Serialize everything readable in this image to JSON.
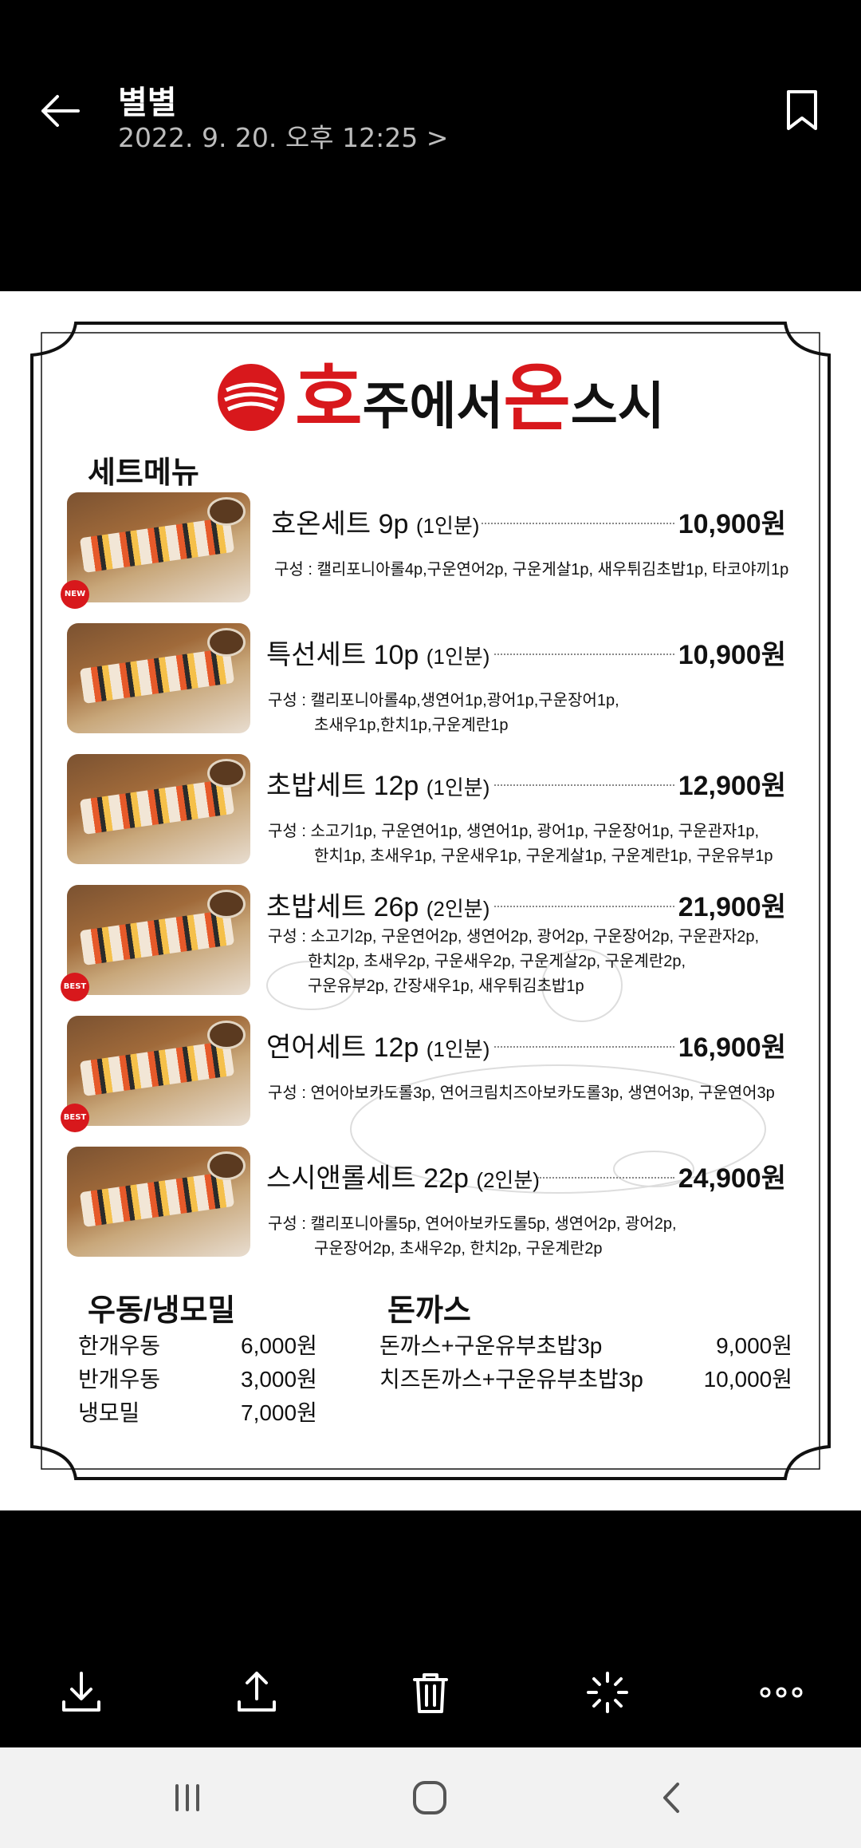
{
  "header": {
    "title": "별별",
    "subtitle": "2022. 9. 20. 오후 12:25 >"
  },
  "menu": {
    "logo": {
      "part1": "호",
      "part2": "주에서",
      "part3": "온",
      "part4": "스시"
    },
    "section_set": "세트메뉴",
    "items": [
      {
        "name": "호온세트 9p",
        "serving": "(1인분)",
        "price": "10,900원",
        "desc1": "구성 : 캘리포니아롤4p,구운연어2p, 구운게살1p, 새우튀김초밥1p, 타코야끼1p",
        "desc2": "",
        "badge": "NEW"
      },
      {
        "name": "특선세트 10p",
        "serving": "(1인분)",
        "price": "10,900원",
        "desc1": "구성 : 캘리포니아롤4p,생연어1p,광어1p,구운장어1p,",
        "desc2": "초새우1p,한치1p,구운계란1p",
        "badge": ""
      },
      {
        "name": "초밥세트 12p",
        "serving": "(1인분)",
        "price": "12,900원",
        "desc1": "구성 : 소고기1p, 구운연어1p, 생연어1p, 광어1p, 구운장어1p, 구운관자1p,",
        "desc2": "한치1p, 초새우1p, 구운새우1p, 구운게살1p, 구운계란1p, 구운유부1p",
        "badge": ""
      },
      {
        "name": "초밥세트 26p",
        "serving": "(2인분)",
        "price": "21,900원",
        "desc1": "구성 : 소고기2p, 구운연어2p, 생연어2p, 광어2p, 구운장어2p, 구운관자2p,",
        "desc2": "한치2p, 초새우2p, 구운새우2p, 구운게살2p, 구운계란2p,",
        "desc3": "구운유부2p, 간장새우1p, 새우튀김초밥1p",
        "badge": "BEST"
      },
      {
        "name": "연어세트 12p",
        "serving": "(1인분)",
        "price": "16,900원",
        "desc1": "구성 : 연어아보카도롤3p, 연어크림치즈아보카도롤3p, 생연어3p, 구운연어3p",
        "desc2": "",
        "badge": "BEST"
      },
      {
        "name": "스시앤롤세트 22p",
        "serving": "(2인분)",
        "price": "24,900원",
        "desc1": "구성 : 캘리포니아롤5p, 연어아보카도롤5p, 생연어2p, 광어2p,",
        "desc2": "구운장어2p, 초새우2p, 한치2p, 구운계란2p",
        "badge": ""
      }
    ],
    "udon": {
      "title": "우동/냉모밀",
      "rows": [
        {
          "name": "한개우동",
          "price": "6,000원"
        },
        {
          "name": "반개우동",
          "price": "3,000원"
        },
        {
          "name": "냉모밀",
          "price": "7,000원"
        }
      ]
    },
    "katsu": {
      "title": "돈까스",
      "rows": [
        {
          "name": "돈까스+구운유부초밥3p",
          "price": "9,000원"
        },
        {
          "name": "치즈돈까스+구운유부초밥3p",
          "price": "10,000원"
        }
      ]
    }
  },
  "toolbar": {
    "icons": [
      "download-icon",
      "share-icon",
      "delete-icon",
      "edit-effect-icon",
      "more-icon"
    ]
  },
  "colors": {
    "brand_red": "#d8181c",
    "background": "#000000",
    "navbar": "#f2f2f2"
  }
}
